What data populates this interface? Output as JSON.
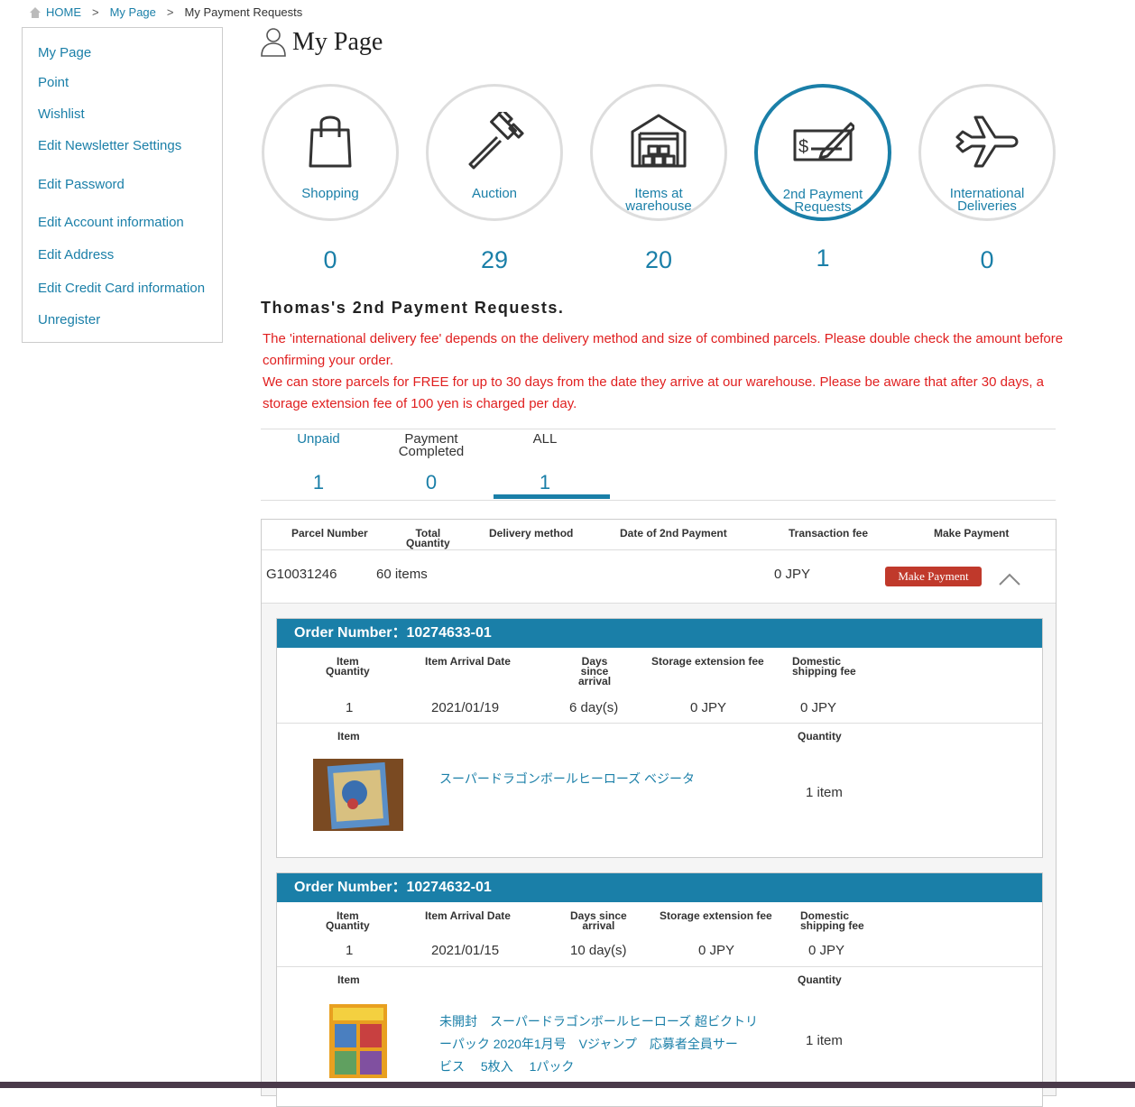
{
  "breadcrumb": {
    "home": "HOME",
    "mypage": "My Page",
    "current": "My Payment Requests",
    "sep": ">"
  },
  "sidebar": {
    "items": [
      {
        "label": "My Page"
      },
      {
        "label": "Point"
      },
      {
        "label": "Wishlist"
      },
      {
        "label": "Edit Newsletter Settings"
      },
      {
        "label": "Edit Password"
      },
      {
        "label": "Edit Account information"
      },
      {
        "label": "Edit Address"
      },
      {
        "label": "Edit Credit Card information"
      },
      {
        "label": "Unregister"
      }
    ]
  },
  "page_title": "My Page",
  "categories": [
    {
      "line1": "Shopping",
      "line2": "",
      "count": "0",
      "icon": "shopping-bag-icon"
    },
    {
      "line1": "Auction",
      "line2": "",
      "count": "29",
      "icon": "gavel-icon"
    },
    {
      "line1": "Items at",
      "line2": "warehouse",
      "count": "20",
      "icon": "warehouse-icon"
    },
    {
      "line1": "2nd Payment",
      "line2": "Requests",
      "count": "1",
      "icon": "check-icon"
    },
    {
      "line1": "International",
      "line2": "Deliveries",
      "count": "0",
      "icon": "airplane-icon"
    }
  ],
  "section_title": "Thomas's 2nd Payment Requests.",
  "notice": {
    "line1": "The 'international delivery fee' depends on the delivery method and size of combined parcels. Please double check the amount before confirming your order.",
    "line2": "We can store parcels for FREE for up to 30 days from the date they arrive at our warehouse. Please be aware that after 30 days, a storage extension fee of 100 yen is charged per day."
  },
  "tabs": [
    {
      "line1": "Unpaid",
      "line2": "",
      "count": "1"
    },
    {
      "line1": "Payment",
      "line2": "Completed",
      "count": "0"
    },
    {
      "line1": "ALL",
      "line2": "",
      "count": "1"
    }
  ],
  "parcel_table": {
    "headers": {
      "parcel_number": "Parcel Number",
      "total_qty_1": "Total",
      "total_qty_2": "Quantity",
      "delivery_method": "Delivery method",
      "date_2nd": "Date of 2nd Payment",
      "transaction_fee": "Transaction fee",
      "make_payment": "Make Payment"
    },
    "row": {
      "parcel_number": "G10031246",
      "total_quantity": "60 items",
      "transaction_fee": "0 JPY",
      "button": "Make Payment"
    }
  },
  "orders": [
    {
      "header": "Order Number：10274633-01",
      "labels": {
        "item_qty_1": "Item",
        "item_qty_2": "Quantity",
        "arrival": "Item Arrival Date",
        "days_1": "Days",
        "days_2": "since",
        "days_3": "arrival",
        "storage": "Storage extension fee",
        "domestic_1": "Domestic",
        "domestic_2": "shipping fee",
        "item": "Item",
        "quantity": "Quantity"
      },
      "values": {
        "item_qty": "1",
        "arrival": "2021/01/19",
        "days": "6 day(s)",
        "storage": "0 JPY",
        "domestic": "0 JPY"
      },
      "item": {
        "name_l1": "スーパードラゴンボールヒーローズ ベジータ",
        "name_l2": "",
        "name_l3": "",
        "quantity": "1 item"
      }
    },
    {
      "header": "Order Number：10274632-01",
      "labels": {
        "item_qty_1": "Item",
        "item_qty_2": "Quantity",
        "arrival": "Item Arrival Date",
        "days_1": "Days since",
        "days_2": "arrival",
        "days_3": "",
        "storage": "Storage extension fee",
        "domestic_1": "Domestic",
        "domestic_2": "shipping fee",
        "item": "Item",
        "quantity": "Quantity"
      },
      "values": {
        "item_qty": "1",
        "arrival": "2021/01/15",
        "days": "10 day(s)",
        "storage": "0 JPY",
        "domestic": "0 JPY"
      },
      "item": {
        "name_l1": "未開封　スーパードラゴンボールヒーローズ 超ビクトリ",
        "name_l2": "ーパック 2020年1月号　Vジャンプ　応募者全員サー",
        "name_l3": "ビス　 5枚入　 1パック",
        "quantity": "1 item"
      }
    }
  ],
  "colors": {
    "accent": "#1a7fa8",
    "notice": "#e02020",
    "button": "#c0392b"
  }
}
